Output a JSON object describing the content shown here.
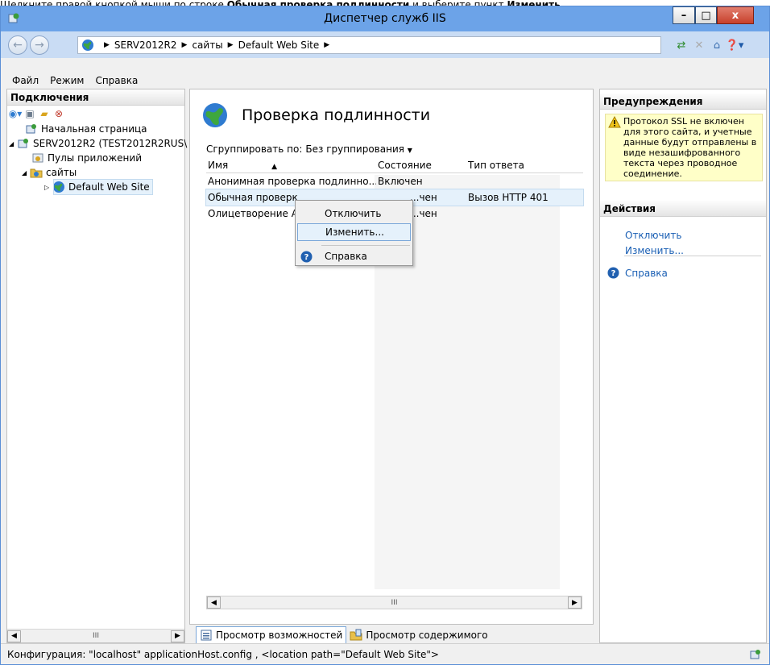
{
  "caption": {
    "part1": "Щелкните правой кнопкой мыши по строке ",
    "bold1": "Обычная проверка подлинности",
    "part2": " и выберите пункт ",
    "bold2": "Изменить"
  },
  "window": {
    "title": "Диспетчер служб IIS",
    "controls": {
      "minimize": "–",
      "maximize": "□",
      "close": "x"
    }
  },
  "address": {
    "segments": [
      "SERV2012R2",
      "сайты",
      "Default Web Site"
    ]
  },
  "menu": [
    "Файл",
    "Режим",
    "Справка"
  ],
  "connections": {
    "header": "Подключения",
    "tree": [
      {
        "label": "Начальная страница"
      },
      {
        "label": "SERV2012R2 (TEST2012R2RUS\\"
      },
      {
        "label": "Пулы приложений"
      },
      {
        "label": "сайты"
      },
      {
        "label": "Default Web Site"
      }
    ],
    "scroll_thumb": "III"
  },
  "feature": {
    "title": "Проверка подлинности",
    "group_by_label": "Сгруппировать по:",
    "group_by_value": "Без группирования",
    "columns": [
      "Имя",
      "Состояние",
      "Тип ответа"
    ],
    "rows": [
      {
        "name": "Анонимная проверка подлинно...",
        "state": "Включен",
        "response": ""
      },
      {
        "name": "Обычная проверк",
        "state": "...чен",
        "response": "Вызов HTTP 401"
      },
      {
        "name": "Олицетворение AS",
        "state": "...чен",
        "response": ""
      }
    ],
    "scroll_thumb": "III"
  },
  "context_menu": {
    "items": [
      "Отключить",
      "Изменить...",
      "Справка"
    ]
  },
  "view_tabs": [
    "Просмотр возможностей",
    "Просмотр содержимого"
  ],
  "alerts": {
    "header": "Предупреждения",
    "text": "Протокол SSL не включен для этого сайта, и учетные данные будут отправлены в виде незашифрованного текста через проводное соединение."
  },
  "actions": {
    "header": "Действия",
    "items": [
      "Отключить",
      "Изменить...",
      "Справка"
    ]
  },
  "status": "Конфигурация: \"localhost\" applicationHost.config , <location path=\"Default Web Site\">",
  "colors": {
    "titlebar": "#6ca3e8",
    "link": "#1a5fb4",
    "selection": "#e5f1fb",
    "warning_bg": "#ffffc8"
  }
}
